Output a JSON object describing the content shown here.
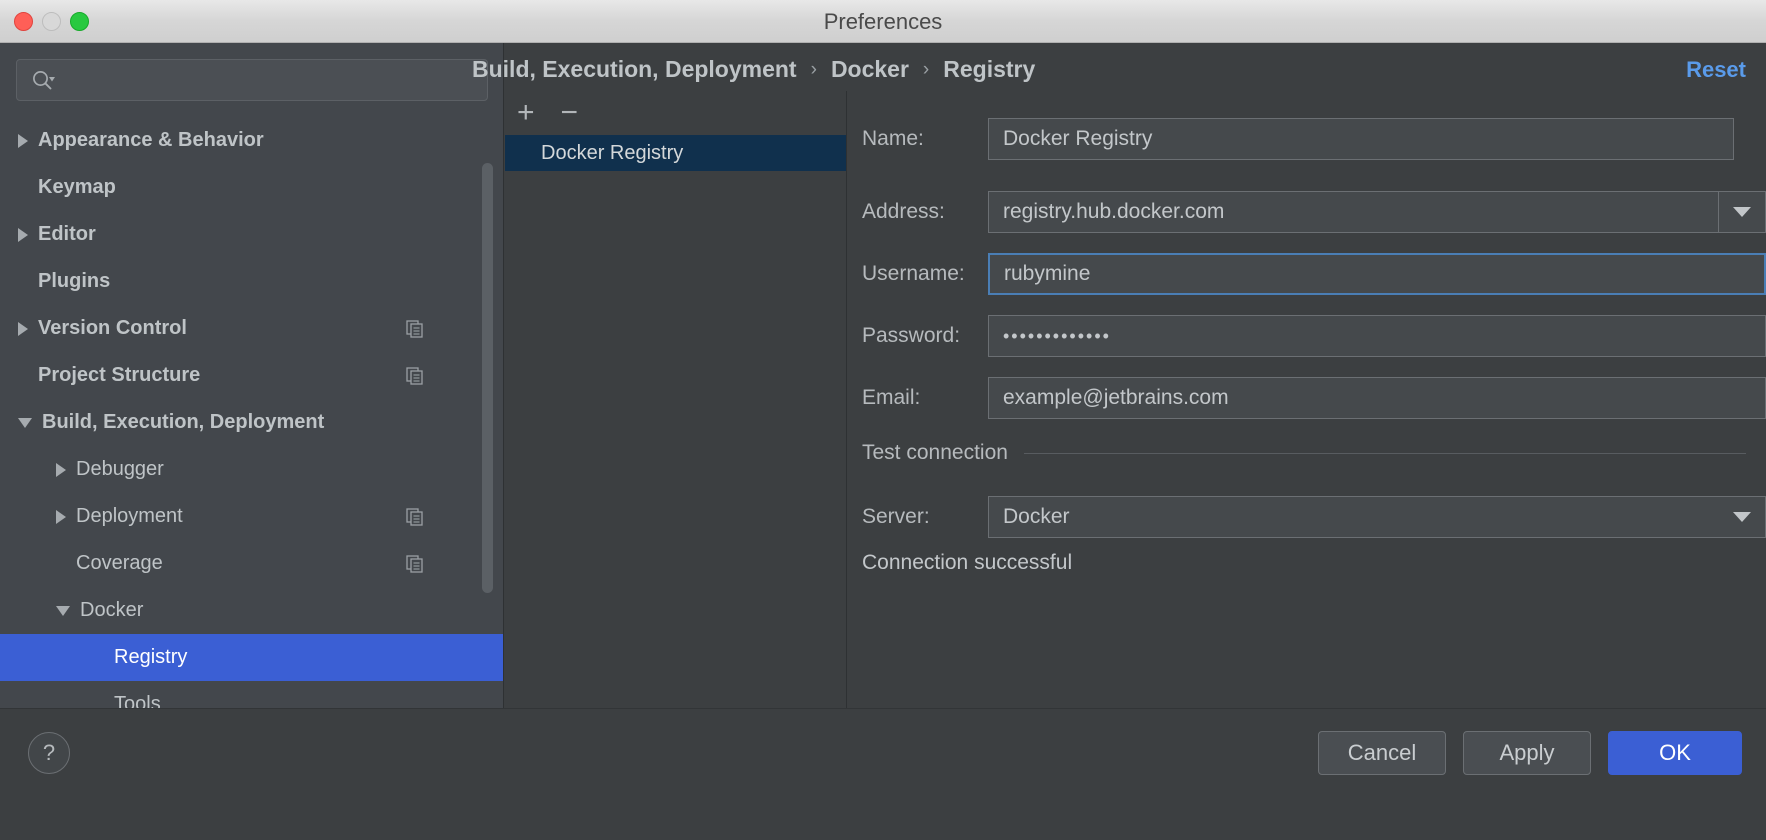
{
  "window": {
    "title": "Preferences",
    "traffic_lights": [
      "close-button",
      "minimize-button",
      "maximize-button"
    ]
  },
  "search": {
    "value": "",
    "placeholder": "",
    "icon": "search-icon"
  },
  "sidebar": {
    "items": [
      {
        "label": "Appearance & Behavior",
        "arrow": "right",
        "indent": 0,
        "bold": true,
        "copy": false,
        "selected": false
      },
      {
        "label": "Keymap",
        "arrow": "none",
        "indent": 0,
        "bold": true,
        "copy": false,
        "selected": false
      },
      {
        "label": "Editor",
        "arrow": "right",
        "indent": 0,
        "bold": true,
        "copy": false,
        "selected": false
      },
      {
        "label": "Plugins",
        "arrow": "none",
        "indent": 0,
        "bold": true,
        "copy": false,
        "selected": false
      },
      {
        "label": "Version Control",
        "arrow": "right",
        "indent": 0,
        "bold": true,
        "copy": true,
        "selected": false
      },
      {
        "label": "Project Structure",
        "arrow": "none",
        "indent": 0,
        "bold": true,
        "copy": true,
        "selected": false
      },
      {
        "label": "Build, Execution, Deployment",
        "arrow": "down",
        "indent": 0,
        "bold": true,
        "copy": false,
        "selected": false
      },
      {
        "label": "Debugger",
        "arrow": "right",
        "indent": 1,
        "bold": false,
        "copy": false,
        "selected": false
      },
      {
        "label": "Deployment",
        "arrow": "right",
        "indent": 1,
        "bold": false,
        "copy": true,
        "selected": false
      },
      {
        "label": "Coverage",
        "arrow": "none",
        "indent": 1,
        "bold": false,
        "copy": true,
        "selected": false
      },
      {
        "label": "Docker",
        "arrow": "down",
        "indent": 1,
        "bold": false,
        "copy": false,
        "selected": false
      },
      {
        "label": "Registry",
        "arrow": "none",
        "indent": 2,
        "bold": false,
        "copy": false,
        "selected": true
      },
      {
        "label": "Tools",
        "arrow": "none",
        "indent": 2,
        "bold": false,
        "copy": false,
        "selected": false
      }
    ]
  },
  "breadcrumb": {
    "parts": [
      "Build, Execution, Deployment",
      "Docker",
      "Registry"
    ],
    "separator": "›",
    "reset_label": "Reset"
  },
  "registry_list": {
    "toolbar": {
      "add_label": "+",
      "remove_label": "−"
    },
    "items": [
      {
        "label": "Docker Registry",
        "selected": true
      }
    ]
  },
  "form": {
    "name": {
      "label": "Name:",
      "value": "Docker Registry"
    },
    "address": {
      "label": "Address:",
      "value": "registry.hub.docker.com"
    },
    "username": {
      "label": "Username:",
      "value": "rubymine",
      "focused": true
    },
    "password": {
      "label": "Password:",
      "value": "•••••••••••••"
    },
    "email": {
      "label": "Email:",
      "value": "example@jetbrains.com"
    },
    "test_connection": {
      "label": "Test connection"
    },
    "server": {
      "label": "Server:",
      "value": "Docker"
    },
    "connection_status": "Connection successful"
  },
  "footer": {
    "help_label": "?",
    "cancel_label": "Cancel",
    "apply_label": "Apply",
    "ok_label": "OK"
  },
  "colors": {
    "accent": "#3b5fd4",
    "link": "#5a9bea",
    "panel": "#3c3f41",
    "sidebar": "#43474c",
    "list_selection_inactive": "#10304d",
    "focus_border": "#4a7eb5"
  }
}
